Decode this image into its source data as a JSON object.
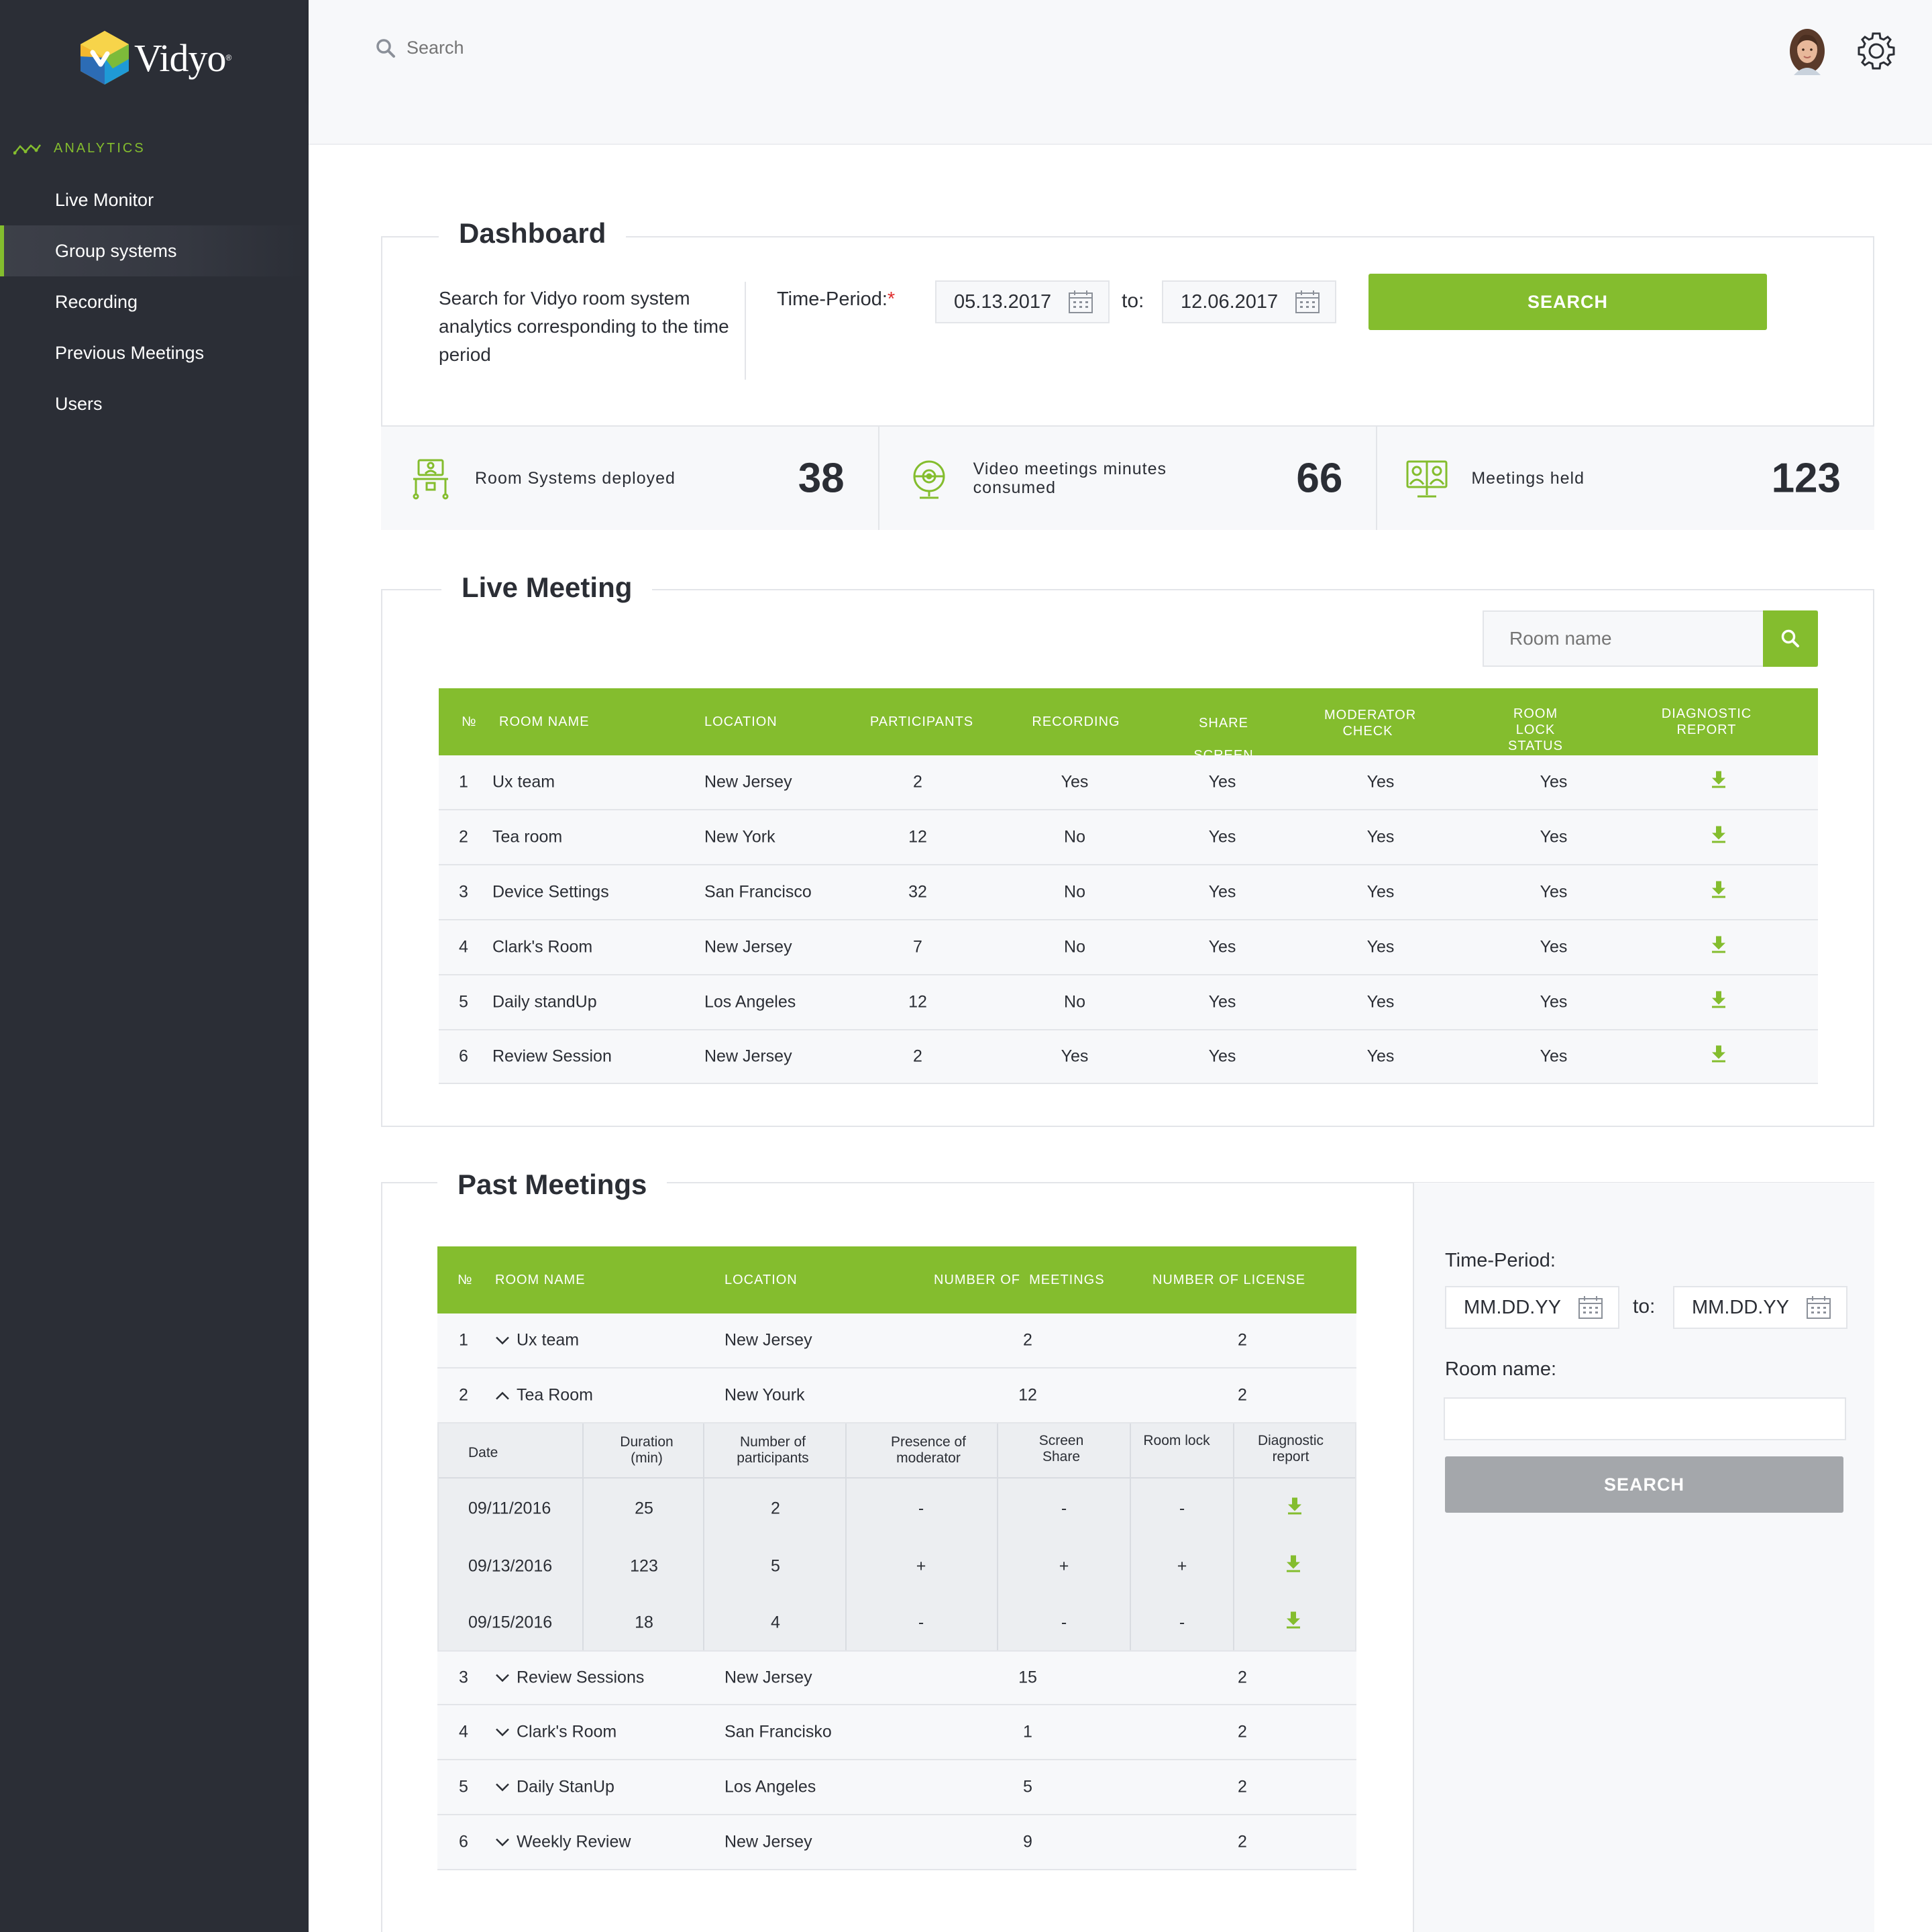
{
  "app": {
    "logo_text": "Vidyo"
  },
  "sidebar": {
    "section_heading": "ANALYTICS",
    "items": [
      {
        "label": "Live Monitor"
      },
      {
        "label": "Group systems"
      },
      {
        "label": "Recording"
      },
      {
        "label": "Previous Meetings"
      },
      {
        "label": "Users"
      }
    ]
  },
  "topbar": {
    "search_placeholder": "Search"
  },
  "dashboard": {
    "title": "Dashboard",
    "description": "Search for Vidyo room system analytics corresponding to the time period",
    "time_period_label": "Time-Period:",
    "required_mark": "*",
    "date_from": "05.13.2017",
    "to_label": "to:",
    "date_to": "12.06.2017",
    "search_button": "SEARCH",
    "stats": [
      {
        "label": "Room Systems deployed",
        "value": "38",
        "icon": "room-system-icon"
      },
      {
        "label": "Video meetings minutes consumed",
        "value": "66",
        "icon": "webcam-icon"
      },
      {
        "label": "Meetings held",
        "value": "123",
        "icon": "meetings-screen-icon"
      }
    ]
  },
  "live_meeting": {
    "title": "Live Meeting",
    "room_search_placeholder": "Room name",
    "columns": [
      "№",
      "ROOM NAME",
      "LOCATION",
      "PARTICIPANTS",
      "RECORDING",
      "SHARE SCREEN",
      "MODERATOR CHECK",
      "ROOM LOCK STATUS",
      "DIAGNOSTIC REPORT"
    ],
    "rows": [
      {
        "no": "1",
        "room": "Ux team",
        "location": "New Jersey",
        "participants": "2",
        "recording": "Yes",
        "share": "Yes",
        "moderator": "Yes",
        "lock": "Yes"
      },
      {
        "no": "2",
        "room": "Tea room",
        "location": "New York",
        "participants": "12",
        "recording": "No",
        "share": "Yes",
        "moderator": "Yes",
        "lock": "Yes"
      },
      {
        "no": "3",
        "room": "Device Settings",
        "location": "San Francisco",
        "participants": "32",
        "recording": "No",
        "share": "Yes",
        "moderator": "Yes",
        "lock": "Yes"
      },
      {
        "no": "4",
        "room": "Clark's Room",
        "location": "New Jersey",
        "participants": "7",
        "recording": "No",
        "share": "Yes",
        "moderator": "Yes",
        "lock": "Yes"
      },
      {
        "no": "5",
        "room": "Daily standUp",
        "location": "Los Angeles",
        "participants": "12",
        "recording": "No",
        "share": "Yes",
        "moderator": "Yes",
        "lock": "Yes"
      },
      {
        "no": "6",
        "room": "Review Session",
        "location": "New Jersey",
        "participants": "2",
        "recording": "Yes",
        "share": "Yes",
        "moderator": "Yes",
        "lock": "Yes"
      }
    ]
  },
  "past_meetings": {
    "title": "Past Meetings",
    "columns": [
      "№",
      "ROOM NAME",
      "LOCATION",
      "NUMBER OF  MEETINGS",
      "NUMBER OF LICENSE"
    ],
    "rows": [
      {
        "no": "1",
        "room": "Ux team",
        "location": "New Jersey",
        "meetings": "2",
        "licenses": "2"
      },
      {
        "no": "2",
        "room": "Tea Room",
        "location": "New Yourk",
        "meetings": "12",
        "licenses": "2"
      },
      {
        "no": "3",
        "room": "Review Sessions",
        "location": "New Jersey",
        "meetings": "15",
        "licenses": "2"
      },
      {
        "no": "4",
        "room": "Clark's Room",
        "location": "San Francisko",
        "meetings": "1",
        "licenses": "2"
      },
      {
        "no": "5",
        "room": "Daily StanUp",
        "location": "Los Angeles",
        "meetings": "5",
        "licenses": "2"
      },
      {
        "no": "6",
        "room": "Weekly Review",
        "location": "New Jersey",
        "meetings": "9",
        "licenses": "2"
      }
    ],
    "detail": {
      "columns": [
        "Date",
        "Duration (min)",
        "Number of participants",
        "Presence of  moderator",
        "Screen Share",
        "Room lock",
        "Diagnostic report"
      ],
      "rows": [
        {
          "date": "09/11/2016",
          "duration": "25",
          "participants": "2",
          "moderator": "-",
          "share": "-",
          "lock": "-"
        },
        {
          "date": "09/13/2016",
          "duration": "123",
          "participants": "5",
          "moderator": "+",
          "share": "+",
          "lock": "+"
        },
        {
          "date": "09/15/2016",
          "duration": "18",
          "participants": "4",
          "moderator": "-",
          "share": "-",
          "lock": "-"
        }
      ]
    },
    "filter": {
      "time_period_label": "Time-Period:",
      "date_from": "MM.DD.YY",
      "to_label": "to:",
      "date_to": "MM.DD.YY",
      "room_name_label": "Room name:",
      "room_name_value": "",
      "search_button": "SEARCH"
    }
  },
  "colors": {
    "accent": "#84bd2e",
    "sidebar": "#2b2e36",
    "disabled_button": "#a4a7ab"
  }
}
